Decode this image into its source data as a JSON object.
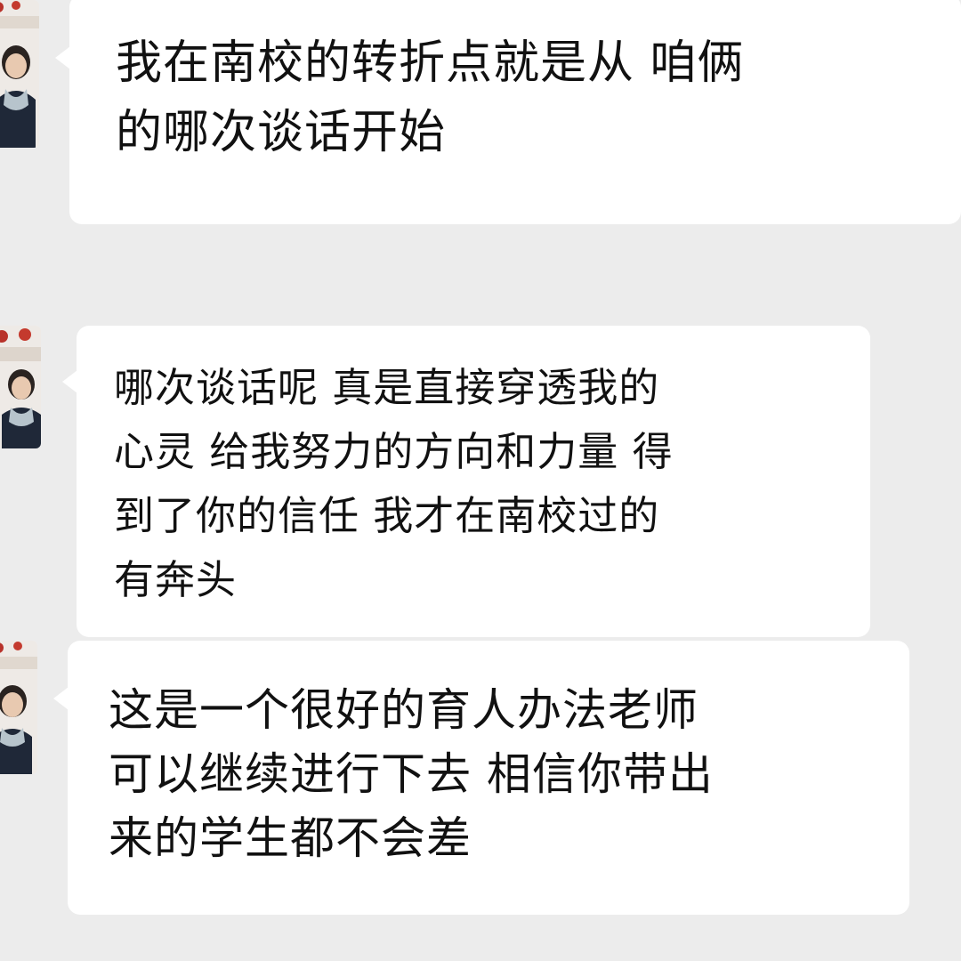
{
  "messages": [
    {
      "id": "m1",
      "sender": "contact",
      "text": "我在南校的转折点就是从 咱俩\n的哪次谈话开始"
    },
    {
      "id": "m2",
      "sender": "contact",
      "text": "哪次谈话呢 真是直接穿透我的\n心灵 给我努力的方向和力量  得\n到了你的信任 我才在南校过的\n有奔头"
    },
    {
      "id": "m3",
      "sender": "contact",
      "text": "这是一个很好的育人办法老师\n可以继续进行下去 相信你带出\n来的学生都不会差"
    }
  ],
  "colors": {
    "background": "#ececec",
    "bubble": "#ffffff",
    "text": "#111111"
  },
  "icons": {
    "avatar": "contact-avatar-photo"
  }
}
